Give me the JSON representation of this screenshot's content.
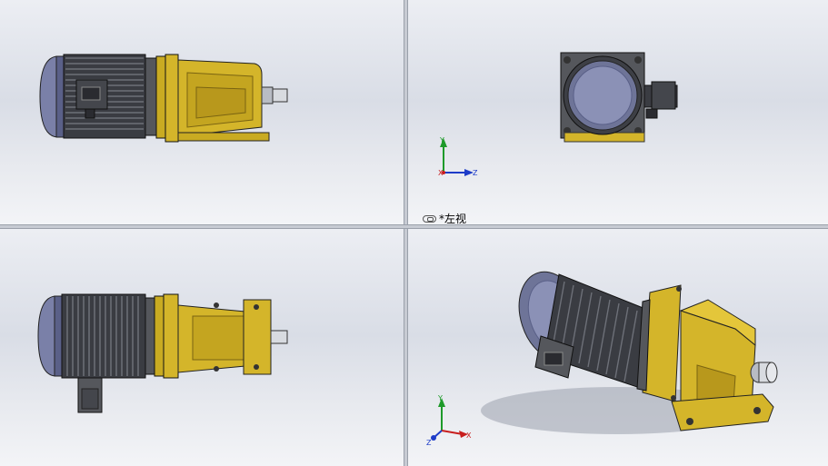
{
  "viewports": {
    "top_left": {
      "view": "front"
    },
    "top_right": {
      "view": "left",
      "label": "*左视"
    },
    "bottom_left": {
      "view": "top"
    },
    "bottom_right": {
      "view": "isometric"
    }
  },
  "triad": {
    "x": "X",
    "y": "Y",
    "z": "Z"
  },
  "colors": {
    "housing": "#d4b52a",
    "housing_dark": "#8c7410",
    "motor": "#55575c",
    "motor_cap": "#8a90b0",
    "axis_x": "#c81e1e",
    "axis_y": "#1e9a2a",
    "axis_z": "#1e3cc8"
  }
}
